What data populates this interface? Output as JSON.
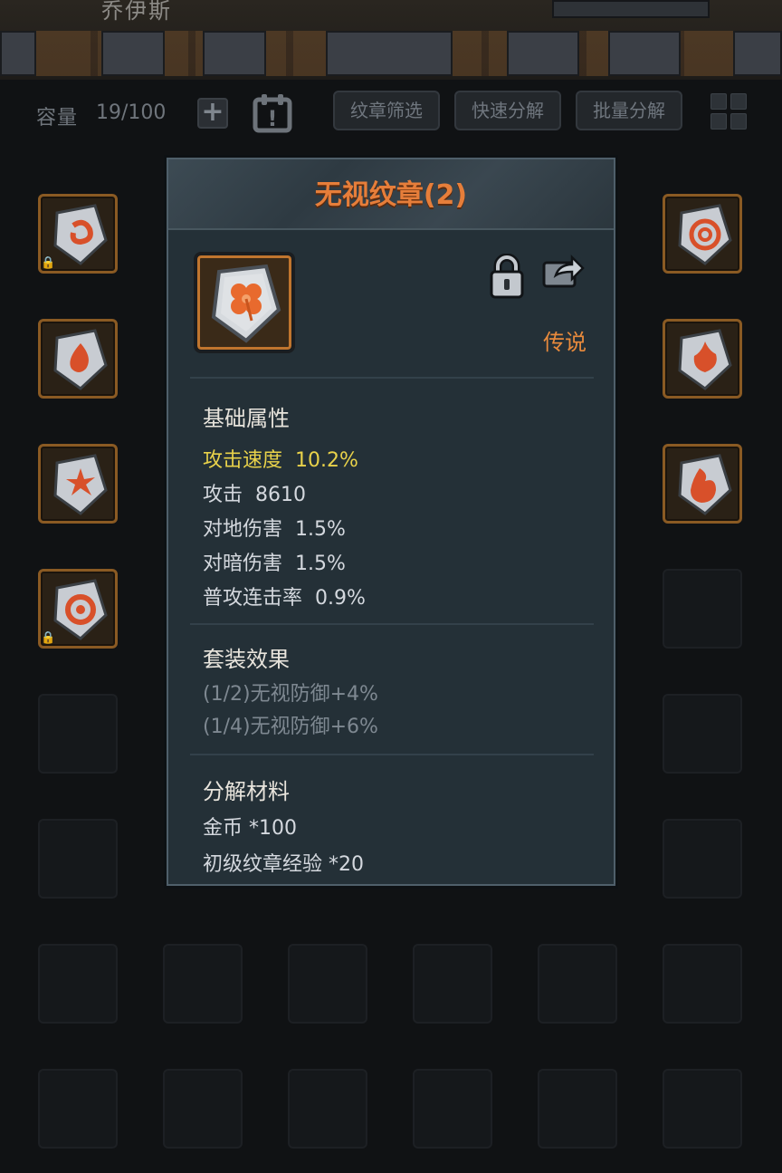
{
  "banner": {
    "hero_name": "乔伊斯"
  },
  "toolbar": {
    "capacity_label": "容量",
    "capacity_value": "19/100",
    "add_symbol": "+",
    "calendar_symbol": "!",
    "buttons": [
      {
        "label": "纹章筛选"
      },
      {
        "label": "快速分解"
      },
      {
        "label": "批量分解"
      }
    ]
  },
  "inventory": {
    "left_column": [
      {
        "icon": "spiral-emblem-icon",
        "locked": true
      },
      {
        "icon": "drop-emblem-icon",
        "locked": false
      },
      {
        "icon": "burst-emblem-icon",
        "locked": false
      },
      {
        "icon": "whirl-emblem-icon",
        "locked": true
      }
    ],
    "right_column": [
      {
        "icon": "circle-emblem-icon",
        "locked": false
      },
      {
        "icon": "flame-emblem-icon",
        "locked": false
      },
      {
        "icon": "fire-emblem-icon",
        "locked": false
      }
    ]
  },
  "modal": {
    "title": "无视纹章(2)",
    "rarity": "传说",
    "rarity_color": "#e88a3c",
    "base_title": "基础属性",
    "base_stats": [
      {
        "text": "攻击速度  10.2%"
      },
      {
        "text": "攻击  8610"
      },
      {
        "text": "对地伤害  1.5%"
      },
      {
        "text": "对暗伤害  1.5%"
      },
      {
        "text": "普攻连击率  0.9%"
      }
    ],
    "set_title": "套装效果",
    "set_effects": [
      {
        "text": "(1/2)无视防御+4%"
      },
      {
        "text": "(1/4)无视防御+6%"
      }
    ],
    "material_title": "分解材料",
    "materials": [
      {
        "text": "金币 *100"
      },
      {
        "text": "初级纹章经验 *20"
      }
    ]
  }
}
